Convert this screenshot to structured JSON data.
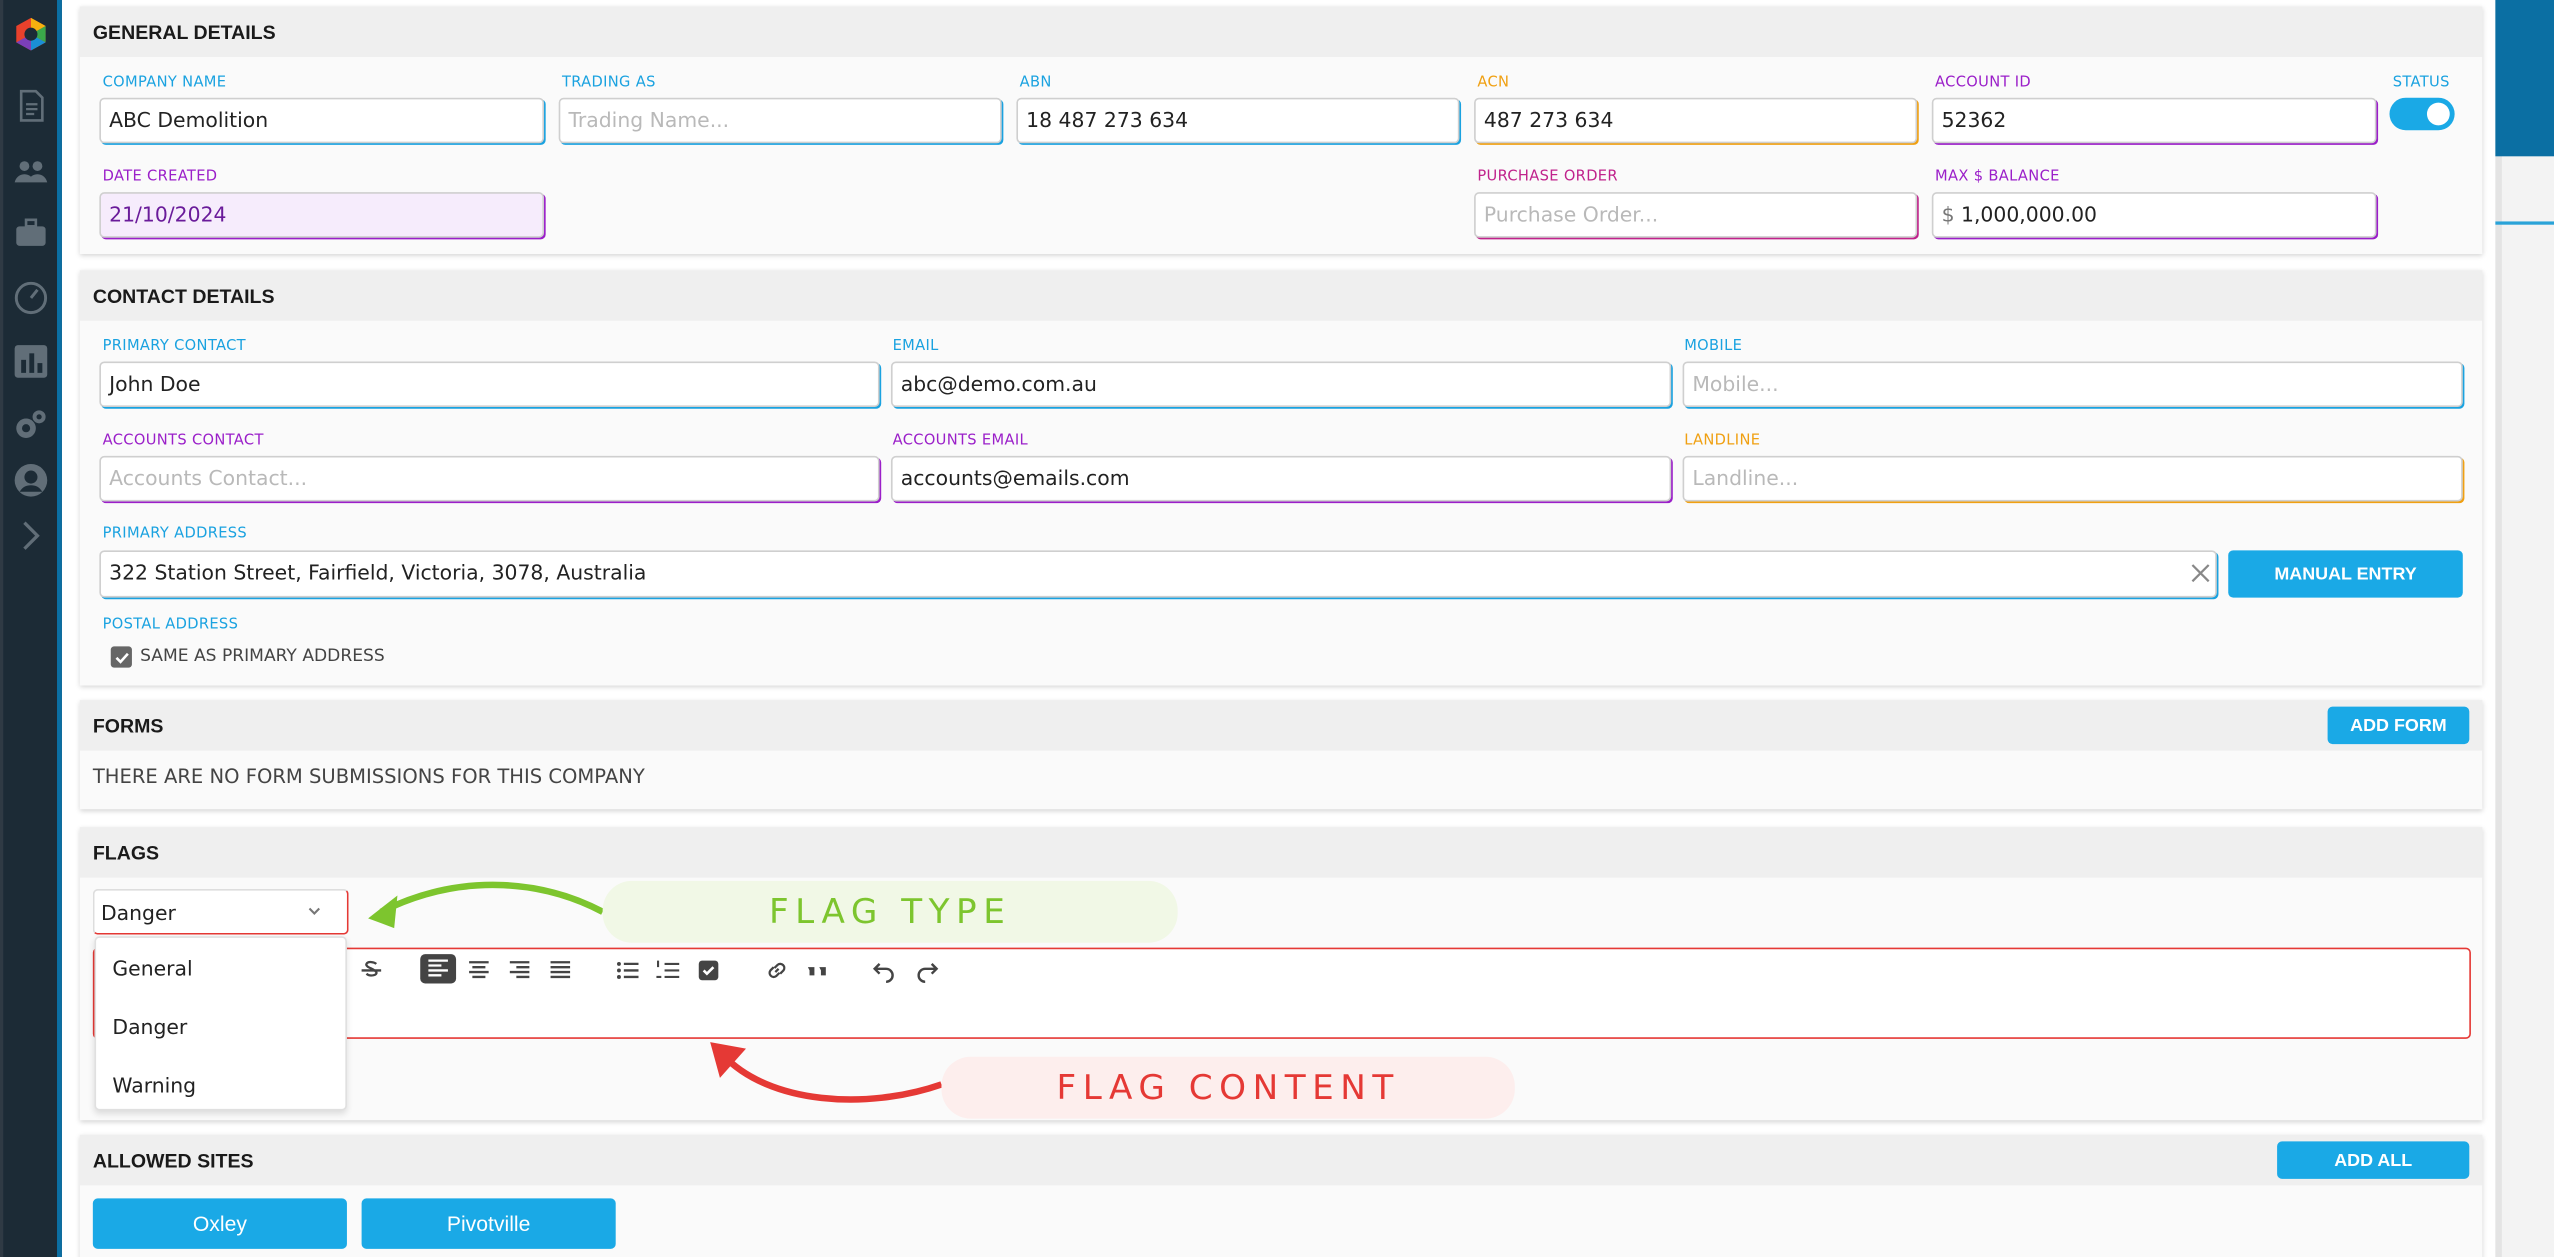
{
  "general": {
    "title": "GENERAL DETAILS",
    "company_name": {
      "label": "COMPANY NAME",
      "value": "ABC Demolition"
    },
    "trading_as": {
      "label": "TRADING AS",
      "placeholder": "Trading Name..."
    },
    "abn": {
      "label": "ABN",
      "value": "18 487 273 634"
    },
    "acn": {
      "label": "ACN",
      "value": "487 273 634"
    },
    "account_id": {
      "label": "ACCOUNT ID",
      "value": "52362"
    },
    "status": {
      "label": "STATUS",
      "on": true
    },
    "date_created": {
      "label": "DATE CREATED",
      "value": "21/10/2024"
    },
    "purchase_order": {
      "label": "PURCHASE ORDER",
      "placeholder": "Purchase Order..."
    },
    "max_balance": {
      "label": "MAX $ BALANCE",
      "prefix": "$",
      "value": "1,000,000.00"
    }
  },
  "contact": {
    "title": "CONTACT DETAILS",
    "primary_contact": {
      "label": "PRIMARY CONTACT",
      "value": "John Doe"
    },
    "email": {
      "label": "EMAIL",
      "value": "abc@demo.com.au"
    },
    "mobile": {
      "label": "MOBILE",
      "placeholder": "Mobile..."
    },
    "accounts_contact": {
      "label": "ACCOUNTS CONTACT",
      "placeholder": "Accounts Contact..."
    },
    "accounts_email": {
      "label": "ACCOUNTS EMAIL",
      "value": "accounts@emails.com"
    },
    "landline": {
      "label": "LANDLINE",
      "placeholder": "Landline..."
    },
    "primary_address": {
      "label": "PRIMARY ADDRESS",
      "value": "322 Station Street, Fairfield, Victoria, 3078, Australia"
    },
    "manual_entry": "MANUAL ENTRY",
    "postal_address": {
      "label": "POSTAL ADDRESS",
      "same_as_primary": "SAME AS PRIMARY ADDRESS",
      "checked": true
    }
  },
  "forms": {
    "title": "FORMS",
    "add_form": "ADD FORM",
    "empty": "THERE ARE NO FORM SUBMISSIONS FOR THIS COMPANY"
  },
  "flags": {
    "title": "FLAGS",
    "selected": "Danger",
    "options": [
      "General",
      "Danger",
      "Warning"
    ],
    "callout_type": "FLAG TYPE",
    "callout_content": "FLAG CONTENT"
  },
  "allowed_sites": {
    "title": "ALLOWED SITES",
    "add_all": "ADD ALL",
    "sites": [
      "Oxley",
      "Pivotville"
    ]
  },
  "colors": {
    "accent": "#1aa9e6",
    "purple": "#9b1fc9",
    "orange": "#f0a012",
    "pink": "#c0238c",
    "danger": "#e53935",
    "callout_green": "#7dc52e",
    "callout_red": "#e53935"
  }
}
